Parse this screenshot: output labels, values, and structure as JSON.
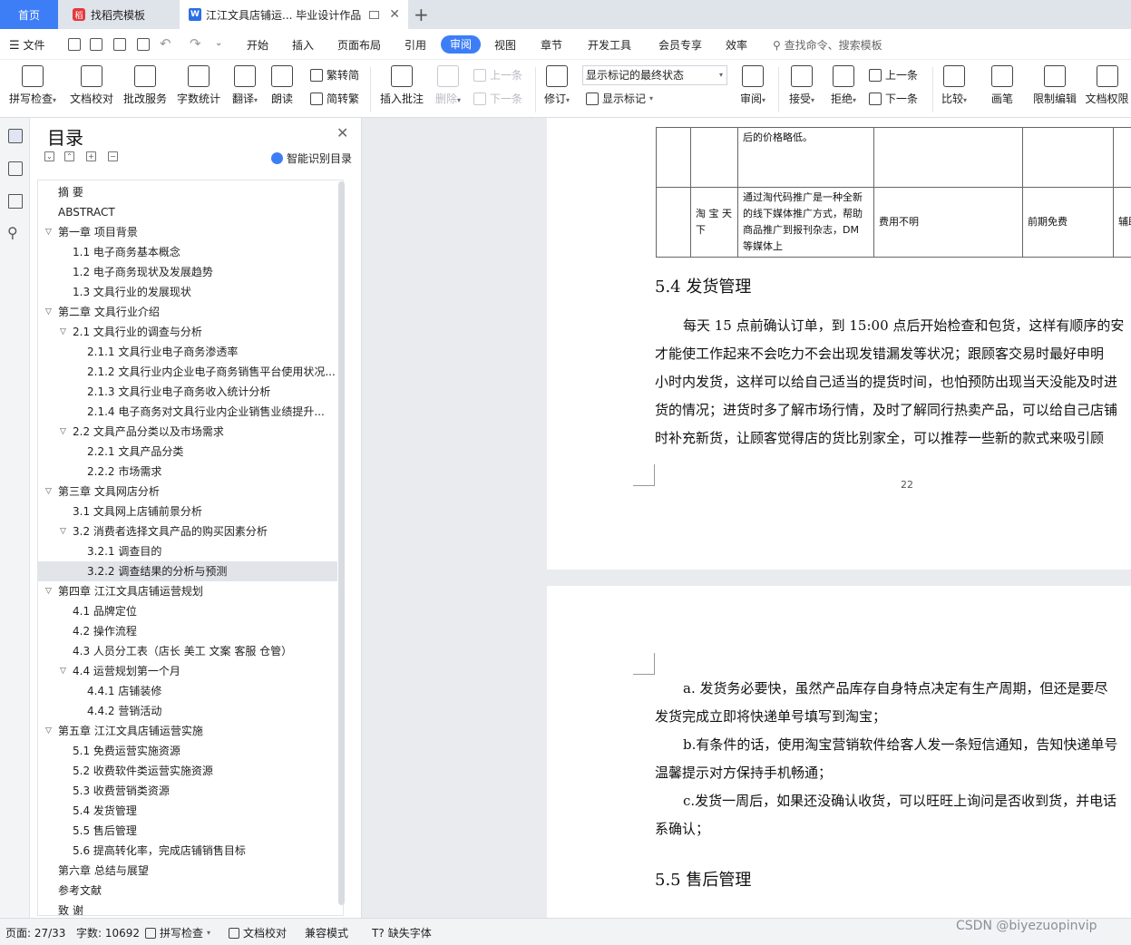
{
  "tabs": {
    "home": "首页",
    "template": "找稻壳模板",
    "document": "江江文具店铺运... 毕业设计作品"
  },
  "menu": {
    "file": "文件",
    "items": [
      "开始",
      "插入",
      "页面布局",
      "引用",
      "审阅",
      "视图",
      "章节",
      "开发工具",
      "会员专享",
      "效率"
    ],
    "active": "审阅",
    "search": "查找命令、搜索模板"
  },
  "ribbon": {
    "spell_check": "拼写检查",
    "doc_proof": "文档校对",
    "batch_service": "批改服务",
    "word_count": "字数统计",
    "translate": "翻译",
    "read_aloud": "朗读",
    "trad_simp": "繁转简",
    "simp_trad": "简转繁",
    "insert_comment": "插入批注",
    "delete": "删除",
    "prev_comment": "上一条",
    "next_comment": "下一条",
    "track": "修订",
    "markup_state": "显示标记的最终状态",
    "show_markup": "显示标记",
    "review": "审阅",
    "accept": "接受",
    "reject": "拒绝",
    "prev_change": "上一条",
    "next_change": "下一条",
    "compare": "比较",
    "pen": "画笔",
    "restrict_edit": "限制编辑",
    "doc_perm": "文档权限"
  },
  "toc": {
    "title": "目录",
    "smart": "智能识别目录",
    "items": [
      {
        "level": 0,
        "text": "摘    要",
        "arrow": ""
      },
      {
        "level": 0,
        "text": "ABSTRACT",
        "arrow": ""
      },
      {
        "level": 0,
        "text": "第一章  项目背景",
        "arrow": "v"
      },
      {
        "level": 1,
        "text": "1.1 电子商务基本概念",
        "arrow": ""
      },
      {
        "level": 1,
        "text": "1.2 电子商务现状及发展趋势",
        "arrow": ""
      },
      {
        "level": 1,
        "text": "1.3 文具行业的发展现状",
        "arrow": ""
      },
      {
        "level": 0,
        "text": "第二章  文具行业介绍",
        "arrow": "v"
      },
      {
        "level": 1,
        "text": "2.1 文具行业的调查与分析",
        "arrow": "v"
      },
      {
        "level": 2,
        "text": "2.1.1 文具行业电子商务渗透率",
        "arrow": ""
      },
      {
        "level": 2,
        "text": "2.1.2 文具行业内企业电子商务销售平台使用状况...",
        "arrow": ""
      },
      {
        "level": 2,
        "text": "2.1.3 文具行业电子商务收入统计分析",
        "arrow": ""
      },
      {
        "level": 2,
        "text": "2.1.4 电子商务对文具行业内企业销售业绩提升...",
        "arrow": ""
      },
      {
        "level": 1,
        "text": "2.2 文具产品分类以及市场需求",
        "arrow": "v"
      },
      {
        "level": 2,
        "text": "2.2.1 文具产品分类",
        "arrow": ""
      },
      {
        "level": 2,
        "text": "2.2.2 市场需求",
        "arrow": ""
      },
      {
        "level": 0,
        "text": "第三章  文具网店分析",
        "arrow": "v"
      },
      {
        "level": 1,
        "text": "3.1 文具网上店铺前景分析",
        "arrow": ""
      },
      {
        "level": 1,
        "text": "3.2 消费者选择文具产品的购买因素分析",
        "arrow": "v"
      },
      {
        "level": 2,
        "text": "3.2.1 调查目的",
        "arrow": ""
      },
      {
        "level": 2,
        "text": "3.2.2 调查结果的分析与预测",
        "arrow": "",
        "selected": true
      },
      {
        "level": 0,
        "text": "第四章  江江文具店铺运营规划",
        "arrow": "v"
      },
      {
        "level": 1,
        "text": "4.1 品牌定位",
        "arrow": ""
      },
      {
        "level": 1,
        "text": "4.2 操作流程",
        "arrow": ""
      },
      {
        "level": 1,
        "text": "4.3 人员分工表（店长  美工  文案  客服  仓管）",
        "arrow": ""
      },
      {
        "level": 1,
        "text": "4.4 运营规划第一个月",
        "arrow": "v"
      },
      {
        "level": 2,
        "text": "4.4.1 店铺装修",
        "arrow": ""
      },
      {
        "level": 2,
        "text": "4.4.2 营销活动",
        "arrow": ""
      },
      {
        "level": 0,
        "text": "第五章  江江文具店铺运营实施",
        "arrow": "v"
      },
      {
        "level": 1,
        "text": "5.1 免费运营实施资源",
        "arrow": ""
      },
      {
        "level": 1,
        "text": "5.2 收费软件类运营实施资源",
        "arrow": ""
      },
      {
        "level": 1,
        "text": "5.3 收费营销类资源",
        "arrow": ""
      },
      {
        "level": 1,
        "text": "5.4 发货管理",
        "arrow": ""
      },
      {
        "level": 1,
        "text": "5.5 售后管理",
        "arrow": ""
      },
      {
        "level": 1,
        "text": "5.6 提高转化率，完成店铺销售目标",
        "arrow": ""
      },
      {
        "level": 0,
        "text": "第六章  总结与展望",
        "arrow": ""
      },
      {
        "level": 0,
        "text": "参考文献",
        "arrow": ""
      },
      {
        "level": 0,
        "text": "致      谢",
        "arrow": ""
      }
    ]
  },
  "doc": {
    "table": {
      "row1_desc": "后的价格略低。",
      "row2_name": "淘 宝 天下",
      "row2_desc": "通过淘代码推广是一种全新的线下媒体推广方式，帮助商品推广到报刊杂志，DM 等媒体上",
      "row2_cost": "费用不明",
      "row2_term": "前期免费",
      "row2_extra": "辅助"
    },
    "heading_54": "5.4 发货管理",
    "p1": [
      "每天 15 点前确认订单，到 15:00 点后开始检查和包货，这样有顺序的安",
      "才能使工作起来不会吃力不会出现发错漏发等状况；跟顾客交易时最好申明",
      "小时内发货，这样可以给自己适当的提货时间，也怕预防出现当天没能及时进",
      "货的情况；进货时多了解市场行情，及时了解同行热卖产品，可以给自己店铺",
      "时补充新货，让顾客觉得店的货比别家全，可以推荐一些新的款式来吸引顾"
    ],
    "page_number": "22",
    "p2": [
      "a. 发货务必要快，虽然产品库存自身特点决定有生产周期，但还是要尽",
      "发货完成立即将快递单号填写到淘宝；",
      "b.有条件的话，使用淘宝营销软件给客人发一条短信通知，告知快递单号",
      "温馨提示对方保持手机畅通；",
      "c.发货一周后，如果还没确认收货，可以旺旺上询问是否收到货，并电话",
      "系确认；"
    ],
    "heading_55": "5.5 售后管理"
  },
  "status": {
    "page": "页面: 27/33",
    "words": "字数: 10692",
    "spell": "拼写检查",
    "proof": "文档校对",
    "compat": "兼容模式",
    "missing_font": "缺失字体"
  },
  "watermark": "CSDN @biyezuopinvip"
}
